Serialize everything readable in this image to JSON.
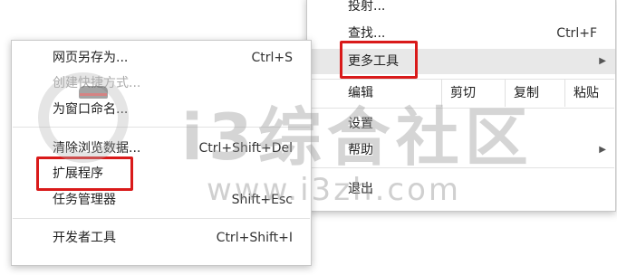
{
  "main_menu": {
    "cast": {
      "label": "投射..."
    },
    "find": {
      "label": "查找...",
      "shortcut": "Ctrl+F"
    },
    "more_tools": {
      "label": "更多工具",
      "arrow": "▶"
    },
    "edit": {
      "label": "编辑",
      "cut": "剪切",
      "copy": "复制",
      "paste": "粘贴"
    },
    "settings": {
      "label": "设置"
    },
    "help": {
      "label": "帮助",
      "arrow": "▶"
    },
    "exit": {
      "label": "退出"
    }
  },
  "submenu": {
    "save_page": {
      "label": "网页另存为...",
      "shortcut": "Ctrl+S"
    },
    "create_shortcut": {
      "label": "创建快捷方式..."
    },
    "name_window": {
      "label": "为窗口命名..."
    },
    "clear_data": {
      "label": "清除浏览数据...",
      "shortcut": "Ctrl+Shift+Del"
    },
    "extensions": {
      "label": "扩展程序"
    },
    "task_manager": {
      "label": "任务管理器",
      "shortcut": "Shift+Esc"
    },
    "dev_tools": {
      "label": "开发者工具",
      "shortcut": "Ctrl+Shift+I"
    }
  },
  "watermark": {
    "title": "i3综合社区",
    "url": "www.i3zh.com"
  },
  "colors": {
    "highlight_border": "#d91a1a",
    "highlight_bg": "#e8e8e8"
  }
}
